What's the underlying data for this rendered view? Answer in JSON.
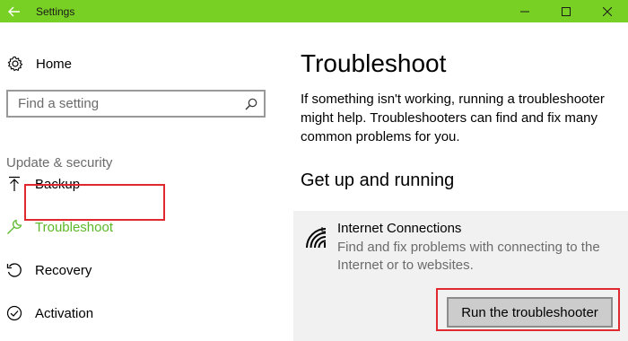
{
  "window": {
    "title": "Settings",
    "titlebar_color": "#79d024"
  },
  "sidebar": {
    "home_label": "Home",
    "search_placeholder": "Find a setting",
    "section_label": "Update & security",
    "items": [
      {
        "label": "Backup",
        "icon": "backup-arrow-icon"
      },
      {
        "label": "Troubleshoot",
        "icon": "wrench-icon",
        "selected": true
      },
      {
        "label": "Recovery",
        "icon": "recovery-icon"
      },
      {
        "label": "Activation",
        "icon": "activation-check-icon"
      }
    ]
  },
  "main": {
    "title": "Troubleshoot",
    "description": "If something isn't working, running a troubleshooter might help. Troubleshooters can find and fix many common problems for you.",
    "subheading": "Get up and running",
    "card": {
      "title": "Internet Connections",
      "description": "Find and fix problems with connecting to the Internet or to websites.",
      "icon": "wifi-signal-icon",
      "button_label": "Run the troubleshooter"
    }
  },
  "colors": {
    "accent_green": "#5cb82a",
    "highlight_red": "#e0292e"
  }
}
